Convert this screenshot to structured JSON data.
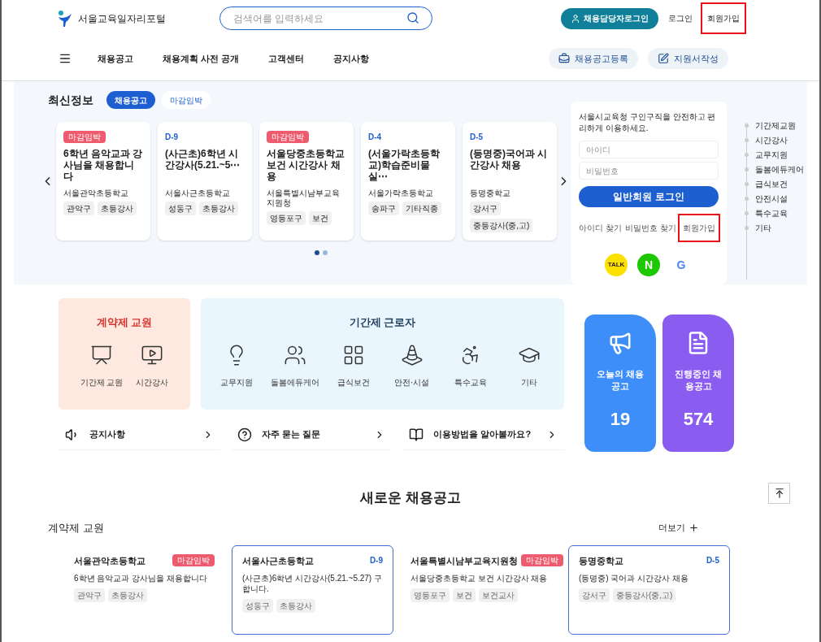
{
  "header": {
    "logo_text": "서울교육일자리포털",
    "search": {
      "placeholder": "검색어를 입력하세요"
    },
    "manager_login": "채용담당자로그인",
    "links": [
      {
        "label": "로그인",
        "annotated": false
      },
      {
        "label": "회원가입",
        "annotated": true
      }
    ]
  },
  "nav": {
    "items": [
      "채용공고",
      "채용계획 사전 공개",
      "고객센터",
      "공지사항"
    ],
    "actions": [
      {
        "kind": "register",
        "label": "채용공고등록"
      },
      {
        "kind": "write",
        "label": "지원서작성"
      }
    ]
  },
  "latest": {
    "title": "최신정보",
    "tabs": [
      {
        "label": "채용공고",
        "selected": true
      },
      {
        "label": "마감임박",
        "selected": false
      }
    ],
    "cards": [
      {
        "badge": {
          "kind": "urgent",
          "text": "마감임박"
        },
        "title": "6학년 음악교과 강사님을 채용합니다",
        "school": "서울관악초등학교",
        "tags": [
          "관악구",
          "초등강사"
        ]
      },
      {
        "badge": {
          "kind": "dday",
          "text": "D-9"
        },
        "title": "(사근초)6학년 시간강사(5.21.~5⋯",
        "school": "서울사근초등학교",
        "tags": [
          "성동구",
          "초등강사"
        ]
      },
      {
        "badge": {
          "kind": "urgent",
          "text": "마감임박"
        },
        "title": "서울당중초등학교 보건 시간강사 채용",
        "school": "서울특별시남부교육지원청",
        "tags": [
          "영등포구",
          "보건"
        ]
      },
      {
        "badge": {
          "kind": "dday",
          "text": "D-4"
        },
        "title": "(서울가락초등학교)학습준비물실⋯",
        "school": "서울가락초등학교",
        "tags": [
          "송파구",
          "기타직종"
        ]
      },
      {
        "badge": {
          "kind": "dday",
          "text": "D-5"
        },
        "title": "(등명중)국어과 시간강사 채용",
        "school": "등명중학교",
        "tags": [
          "강서구",
          "중등강사(중,고)"
        ]
      }
    ],
    "dots": [
      {
        "selected": true
      },
      {
        "selected": false
      }
    ]
  },
  "login": {
    "intro": "서울시교육청 구인구직을 안전하고 편리하게 이용하세요.",
    "id": {
      "placeholder": "아이디"
    },
    "password": {
      "placeholder": "비밀번호"
    },
    "button": "일반회원 로그인",
    "links": [
      {
        "label": "아이디 찾기",
        "annotated": false
      },
      {
        "label": "비밀번호 찾기",
        "annotated": false
      },
      {
        "label": "회원가입",
        "annotated": true
      }
    ],
    "social": [
      {
        "kind": "kakao",
        "label": "TALK"
      },
      {
        "kind": "naver",
        "label": "N"
      },
      {
        "kind": "google",
        "label": "G"
      }
    ]
  },
  "quick_list": [
    "기간제교원",
    "시간강사",
    "교무지원",
    "돌봄에듀케어",
    "급식보건",
    "안전시설",
    "특수교육",
    "기타"
  ],
  "contract_teachers": {
    "title": "계약제 교원",
    "items": [
      "기간제 교원",
      "시간강사"
    ]
  },
  "fixed_term_workers": {
    "title": "기간제 근로자",
    "items": [
      "교무지원",
      "돌봄에듀케어",
      "급식보건",
      "안전·시설",
      "특수교육",
      "기타"
    ]
  },
  "links": [
    {
      "kind": "notice",
      "label": "공지사항"
    },
    {
      "kind": "faq",
      "label": "자주 묻는 질문"
    },
    {
      "kind": "guide",
      "label": "이용방법을 알아볼까요?"
    }
  ],
  "stats": [
    {
      "kind": "today",
      "label": "오늘의 채용공고",
      "count": "19"
    },
    {
      "kind": "ongoing",
      "label": "진행중인 채용공고",
      "count": "574"
    }
  ],
  "new_postings": {
    "title": "새로운 채용공고",
    "section": "계약제 교원",
    "more": "더보기",
    "cards": [
      {
        "school": "서울관악초등학교",
        "badge": {
          "kind": "urgent",
          "text": "마감임박"
        },
        "description": "6학년 음악교과 강사님을 채용합니다",
        "tags": [
          "관악구",
          "초등강사"
        ],
        "highlighted": false
      },
      {
        "school": "서울사근초등학교",
        "badge": {
          "kind": "dday",
          "text": "D-9"
        },
        "description": "(사근초)6학년 시간강사(5.21.~5.27) 구합니다.",
        "tags": [
          "성동구",
          "초등강사"
        ],
        "highlighted": true
      },
      {
        "school": "서울특별시남부교육지원청",
        "badge": {
          "kind": "urgent",
          "text": "마감임박"
        },
        "description": "서울당중초등학교 보건 시간강사 채용",
        "tags": [
          "영등포구",
          "보건",
          "보건교사"
        ],
        "highlighted": false
      },
      {
        "school": "등명중학교",
        "badge": {
          "kind": "dday",
          "text": "D-5"
        },
        "description": "(등명중) 국어과 시간강사 채용",
        "tags": [
          "강서구",
          "중등강사(중,고)"
        ],
        "highlighted": true
      }
    ]
  }
}
